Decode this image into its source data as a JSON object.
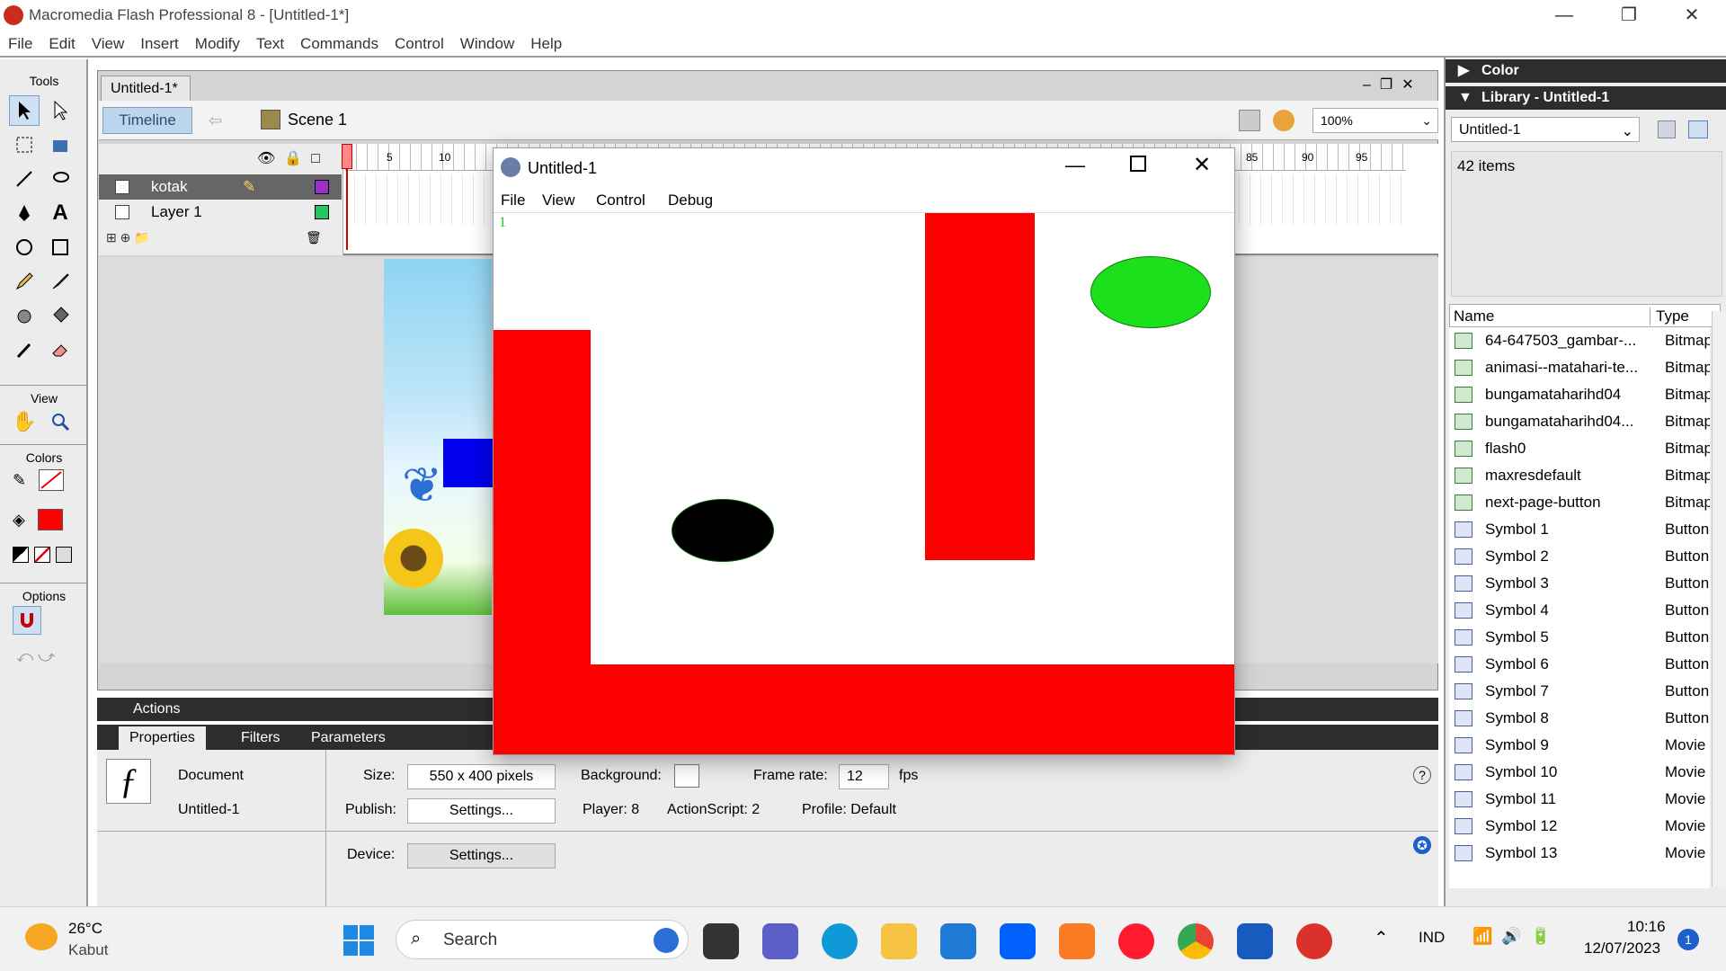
{
  "app": {
    "title": "Macromedia Flash Professional 8 - [Untitled-1*]",
    "window_controls": {
      "minimize": "—",
      "restore": "❐",
      "close": "✕"
    }
  },
  "menubar": [
    "File",
    "Edit",
    "View",
    "Insert",
    "Modify",
    "Text",
    "Commands",
    "Control",
    "Window",
    "Help"
  ],
  "tools": {
    "header": "Tools",
    "view_label": "View",
    "colors_label": "Colors",
    "options_label": "Options",
    "stroke_color": "#000000",
    "fill_color": "#ff0000"
  },
  "document": {
    "tab": "Untitled-1*",
    "timeline_button": "Timeline",
    "scene": "Scene 1",
    "zoom": "100%",
    "frame_numbers": [
      "5",
      "10",
      "85",
      "90",
      "95"
    ],
    "layers": [
      {
        "name": "kotak",
        "color": "#9b30c6",
        "selected": true
      },
      {
        "name": "Layer 1",
        "color": "#22c55e",
        "selected": false
      }
    ]
  },
  "panels": {
    "actions": "Actions",
    "tabs": [
      "Properties",
      "Filters",
      "Parameters"
    ],
    "properties": {
      "type": "Document",
      "name": "Untitled-1",
      "size_label": "Size:",
      "size": "550 x 400 pixels",
      "background_label": "Background:",
      "frame_rate_label": "Frame rate:",
      "frame_rate": "12",
      "fps": "fps",
      "publish_label": "Publish:",
      "settings": "Settings...",
      "player": "Player: 8",
      "actionscript": "ActionScript:  2",
      "profile": "Profile:  Default",
      "device_label": "Device:",
      "device_settings": "Settings..."
    }
  },
  "right_panel": {
    "color_header": "Color",
    "library_header": "Library - Untitled-1",
    "library_select": "Untitled-1",
    "item_count": "42 items",
    "columns": [
      "Name",
      "Type"
    ],
    "items": [
      {
        "name": "64-647503_gambar-...",
        "type": "Bitmap",
        "kind": "bitmap"
      },
      {
        "name": "animasi--matahari-te...",
        "type": "Bitmap",
        "kind": "bitmap"
      },
      {
        "name": "bungamataharihd04",
        "type": "Bitmap",
        "kind": "bitmap"
      },
      {
        "name": "bungamataharihd04...",
        "type": "Bitmap",
        "kind": "bitmap"
      },
      {
        "name": "flash0",
        "type": "Bitmap",
        "kind": "bitmap"
      },
      {
        "name": "maxresdefault",
        "type": "Bitmap",
        "kind": "bitmap"
      },
      {
        "name": "next-page-button",
        "type": "Bitmap",
        "kind": "bitmap"
      },
      {
        "name": "Symbol 1",
        "type": "Button",
        "kind": "button"
      },
      {
        "name": "Symbol 2",
        "type": "Button",
        "kind": "button"
      },
      {
        "name": "Symbol 3",
        "type": "Button",
        "kind": "button"
      },
      {
        "name": "Symbol 4",
        "type": "Button",
        "kind": "button"
      },
      {
        "name": "Symbol 5",
        "type": "Button",
        "kind": "button"
      },
      {
        "name": "Symbol 6",
        "type": "Button",
        "kind": "button"
      },
      {
        "name": "Symbol 7",
        "type": "Button",
        "kind": "button"
      },
      {
        "name": "Symbol 8",
        "type": "Button",
        "kind": "button"
      },
      {
        "name": "Symbol 9",
        "type": "Movie",
        "kind": "movie"
      },
      {
        "name": "Symbol 10",
        "type": "Movie",
        "kind": "movie"
      },
      {
        "name": "Symbol 11",
        "type": "Movie",
        "kind": "movie"
      },
      {
        "name": "Symbol 12",
        "type": "Movie",
        "kind": "movie"
      },
      {
        "name": "Symbol 13",
        "type": "Movie",
        "kind": "movie"
      }
    ]
  },
  "flash_player": {
    "title": "Untitled-1",
    "menu": [
      "File",
      "View",
      "Control",
      "Debug"
    ],
    "frame_counter": "1",
    "colors": {
      "wall": "#ff0000",
      "goal": "#1de01d",
      "ball": "#000000"
    }
  },
  "taskbar": {
    "weather_temp": "26°C",
    "weather_desc": "Kabut",
    "search_placeholder": "Search",
    "lang": "IND",
    "time": "10:16",
    "date": "12/07/2023",
    "notif_count": "1"
  }
}
